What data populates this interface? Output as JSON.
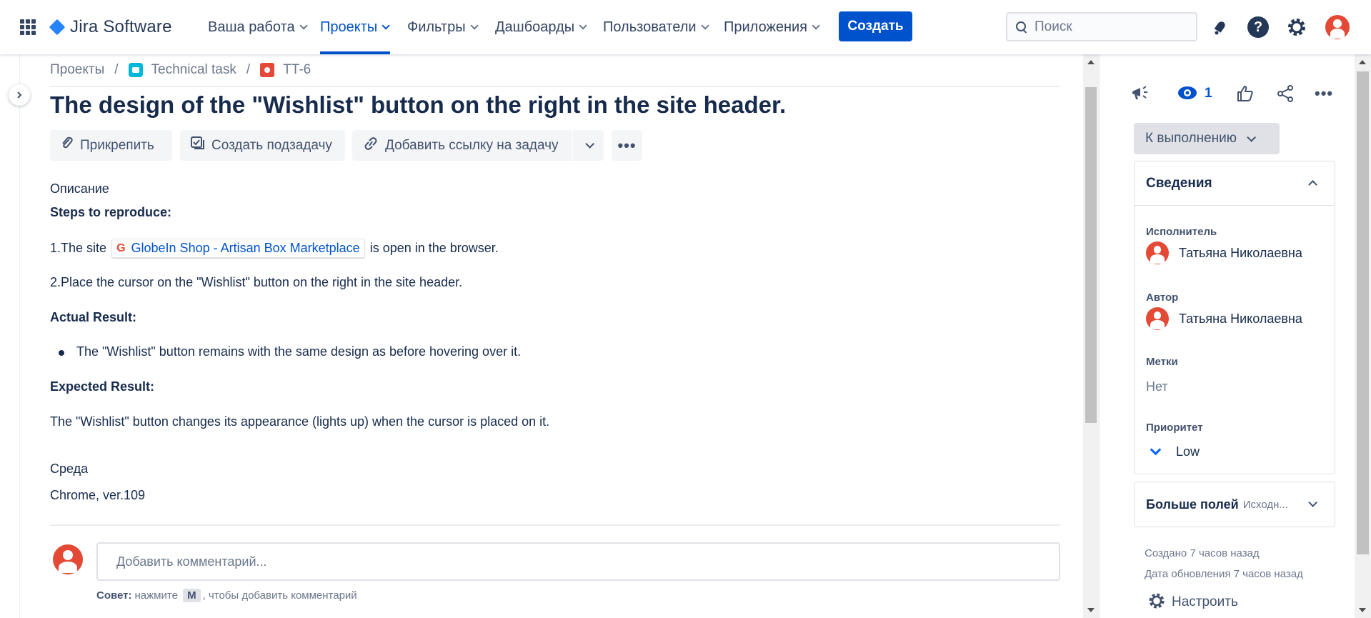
{
  "nav": {
    "logo_text": "Jira Software",
    "items": [
      {
        "label": "Ваша работа"
      },
      {
        "label": "Проекты"
      },
      {
        "label": "Фильтры"
      },
      {
        "label": "Дашбоарды"
      },
      {
        "label": "Пользователи"
      },
      {
        "label": "Приложения"
      }
    ],
    "create_label": "Создать",
    "search_placeholder": "Поиск",
    "help_glyph": "?",
    "accent_color": "#0052cc"
  },
  "breadcrumb": {
    "projects": "Проекты",
    "project_name": "Technical task",
    "issue_key": "TT-6",
    "separator": "/"
  },
  "issue": {
    "title": "The design of the \"Wishlist\" button on the right in the site header.",
    "actions": {
      "attach": "Прикрепить",
      "subtask": "Создать подзадачу",
      "link": "Добавить ссылку на задачу",
      "more": "•••"
    },
    "description_label": "Описание",
    "steps_heading": "Steps to reproduce:",
    "step1_prefix": "1.The site",
    "step1_link_icon": "G",
    "step1_link": "GlobeIn Shop - Artisan Box Marketplace",
    "step1_suffix": "is open in the browser.",
    "step2": "2.Place the cursor on the \"Wishlist\" button on the right in the site header.",
    "actual_heading": "Actual Result:",
    "actual_item": "The \"Wishlist\" button remains with the same design as before hovering over it.",
    "expected_heading": "Expected Result:",
    "expected_text": "The \"Wishlist\" button changes its appearance (lights up) when the cursor is placed on it.",
    "environment_label": "Среда",
    "environment_value": "Chrome, ver.109"
  },
  "comment": {
    "placeholder": "Добавить комментарий...",
    "tip_bold": "Совет:",
    "tip_before": "нажмите",
    "tip_key": "M",
    "tip_after": ", чтобы добавить комментарий"
  },
  "sidebar": {
    "watch_count": "1",
    "more": "•••",
    "status": "К выполнению",
    "details_title": "Сведения",
    "assignee_label": "Исполнитель",
    "assignee_name": "Татьяна Николаевна",
    "reporter_label": "Автор",
    "reporter_name": "Татьяна Николаевна",
    "labels_label": "Метки",
    "labels_value": "Нет",
    "priority_label": "Приоритет",
    "priority_value": "Low",
    "more_fields": "Больше полей",
    "more_fields_sub": "Исходн...",
    "created": "Создано 7 часов назад",
    "updated": "Дата обновления 7 часов назад",
    "configure": "Настроить"
  }
}
